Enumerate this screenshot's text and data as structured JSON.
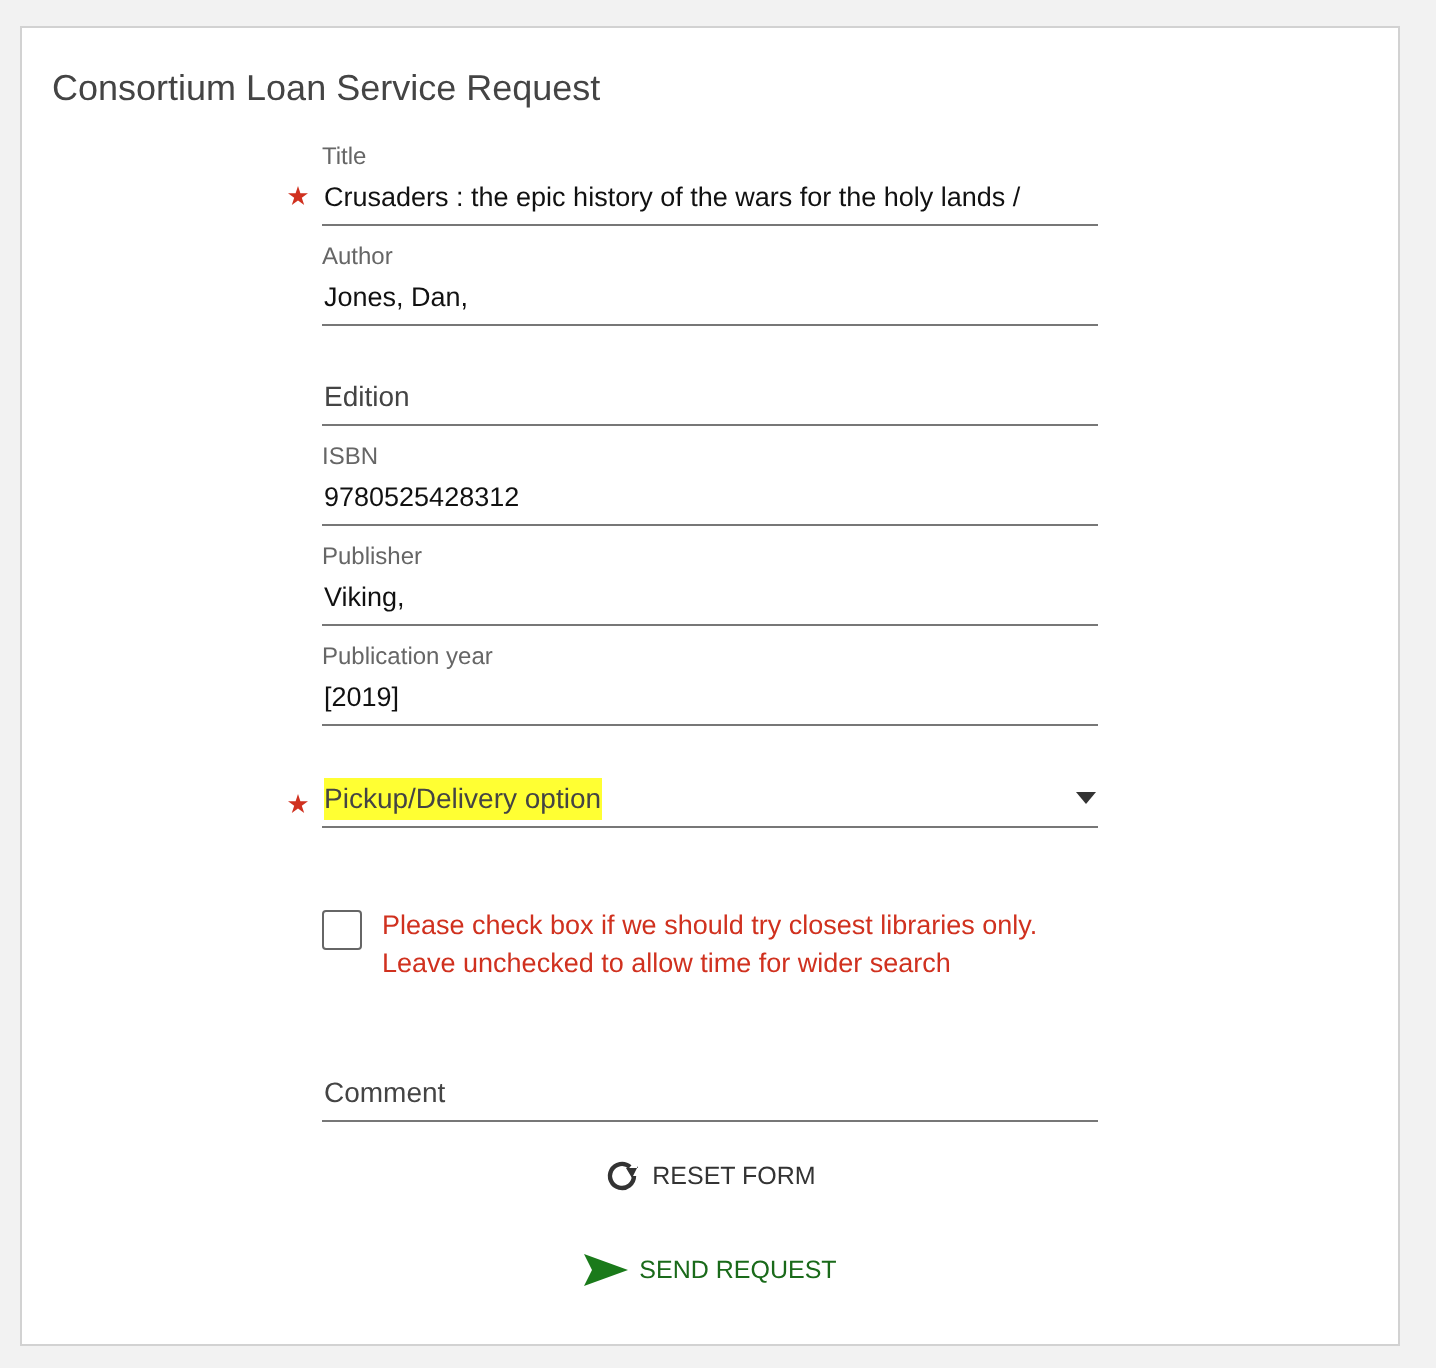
{
  "title": "Consortium Loan Service Request",
  "fields": [
    {
      "kind": "text",
      "label": "Title",
      "value": "Crusaders : the epic history of the wars for the holy lands /",
      "required": true
    },
    {
      "kind": "text",
      "label": "Author",
      "value": "Jones, Dan,",
      "required": false
    },
    {
      "kind": "empty",
      "placeholder": "Edition",
      "required": false
    },
    {
      "kind": "text",
      "label": "ISBN",
      "value": "9780525428312",
      "required": false
    },
    {
      "kind": "text",
      "label": "Publisher",
      "value": "Viking,",
      "required": false
    },
    {
      "kind": "text",
      "label": "Publication year",
      "value": "[2019]",
      "required": false
    },
    {
      "kind": "select",
      "placeholder": "Pickup/Delivery option",
      "required": true,
      "highlighted": true
    }
  ],
  "checkbox": {
    "checked": false,
    "lines": [
      "Please check box if we should try closest libraries only.",
      "Leave unchecked to allow time for wider search"
    ]
  },
  "comment": {
    "placeholder": "Comment"
  },
  "buttons": [
    {
      "kind": "reset",
      "label": "RESET FORM"
    },
    {
      "kind": "send",
      "label": "SEND REQUEST"
    }
  ]
}
